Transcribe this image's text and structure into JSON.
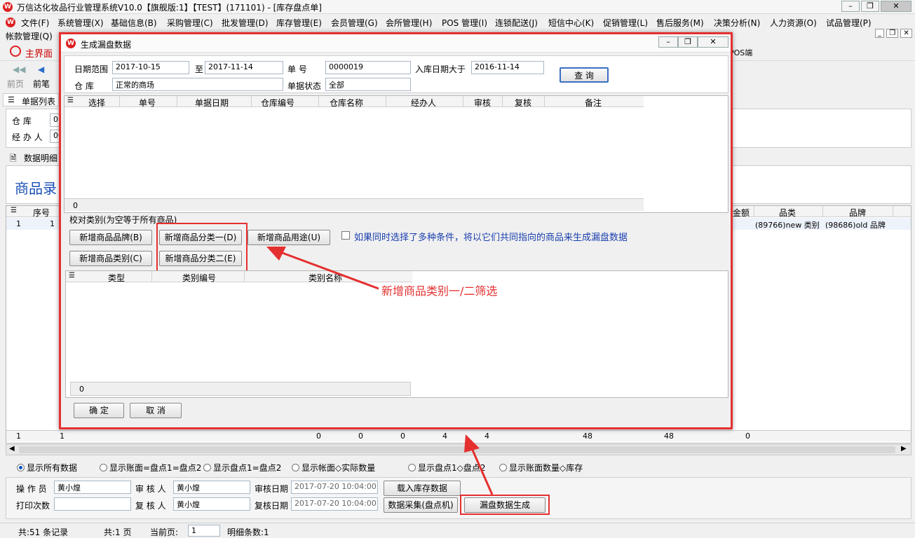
{
  "window": {
    "title": "万信达化妆品行业管理系统V10.0【旗舰版:1】【TEST】(171101) - [库存盘点单]"
  },
  "menu": {
    "row1": [
      "文件(F)",
      "系统管理(X)",
      "基础信息(B)",
      "采购管理(C)",
      "批发管理(D)",
      "库存管理(E)",
      "会员管理(G)",
      "会所管理(H)",
      "POS 管理(I)",
      "连锁配送(J)",
      "短信中心(K)",
      "促销管理(L)",
      "售后服务(M)",
      "决策分析(N)",
      "人力资源(O)",
      "试品管理(P)"
    ],
    "row2": [
      "帐款管理(Q)"
    ]
  },
  "toolbar": {
    "home": "主界面",
    "pos_end": "POS端"
  },
  "nav": {
    "prev_page": "前页",
    "prev_item": "前笔"
  },
  "list_tab": "单据列表",
  "left_labels": {
    "warehouse": "仓    库",
    "handler": "经 办 人",
    "warehouse_value": "01",
    "handler_value": "00"
  },
  "detail_tab": "数据明细",
  "product_entry": "商品录",
  "main_grid": {
    "headers_left": [
      "序号"
    ],
    "headers_right": [
      "金额",
      "品类",
      "品牌"
    ],
    "row": {
      "index": "1",
      "col2": "1",
      "category": "(89766)new 类别",
      "brand": "(98686)old 品牌"
    },
    "totals": {
      "first": "1",
      "second": "1",
      "t1": "0",
      "t2": "0",
      "t3": "0",
      "t4": "4",
      "t5": "4",
      "t6": "48",
      "t7": "48",
      "t8": "0"
    }
  },
  "filters": [
    {
      "label": "显示所有数据",
      "selected": true
    },
    {
      "label": "显示账面=盘点1=盘点2",
      "selected": false
    },
    {
      "label": "显示盘点1=盘点2",
      "selected": false
    },
    {
      "label": "显示帐面◇实际数量",
      "selected": false
    },
    {
      "label": "显示盘点1◇盘点2",
      "selected": false
    },
    {
      "label": "显示账面数量◇库存",
      "selected": false
    }
  ],
  "footer": {
    "operator_label": "操 作 员",
    "operator_value": "黄小煌",
    "auditor_label": "审 核 人",
    "auditor_value": "黄小煌",
    "audit_date_label": "审核日期",
    "audit_date_value": "2017-07-20 10:04:00",
    "print_count_label": "打印次数",
    "print_count_value": "",
    "reviewer_label": "复 核 人",
    "reviewer_value": "黄小煌",
    "review_date_label": "复核日期",
    "review_date_value": "2017-07-20 10:04:00",
    "load_stock_btn": "载入库存数据",
    "collect_btn": "数据采集(盘点机)",
    "generate_btn": "漏盘数据生成"
  },
  "status": {
    "records": "共:51 条记录",
    "pages": "共:1 页",
    "current_page_label": "当前页:",
    "current_page": "1",
    "detail_count": "明细条数:1"
  },
  "dialog": {
    "title": "生成漏盘数据",
    "date_range_label": "日期范围",
    "date_from": "2017-10-15",
    "to_label": "至",
    "date_to": "2017-11-14",
    "doc_no_label": "单    号",
    "doc_no": "0000019",
    "in_date_label": "入库日期大于",
    "in_date": "2016-11-14",
    "query_btn": "查 询",
    "warehouse_label": "仓    库",
    "warehouse_value": "正常的商场",
    "doc_status_label": "单据状态",
    "doc_status": "全部",
    "grid_headers": [
      "选择",
      "单号",
      "单据日期",
      "仓库编号",
      "仓库名称",
      "经办人",
      "审核",
      "复核",
      "备注"
    ],
    "grid_footer": "0",
    "category_hint": "校对类别(为空等于所有商品)",
    "btn_brand": "新增商品品牌(B)",
    "btn_cat1": "新增商品分类一(D)",
    "btn_usage": "新增商品用途(U)",
    "btn_category": "新增商品类别(C)",
    "btn_cat2": "新增商品分类二(E)",
    "multi_condition_note": "如果同时选择了多种条件，将以它们共同指向的商品来生成漏盘数据",
    "cat_grid_headers": [
      "类型",
      "类别编号",
      "类别名称"
    ],
    "cat_grid_footer": "0",
    "ok_btn": "确 定",
    "cancel_btn": "取 消"
  },
  "annotation": {
    "text": "新增商品类别一/二筛选"
  }
}
